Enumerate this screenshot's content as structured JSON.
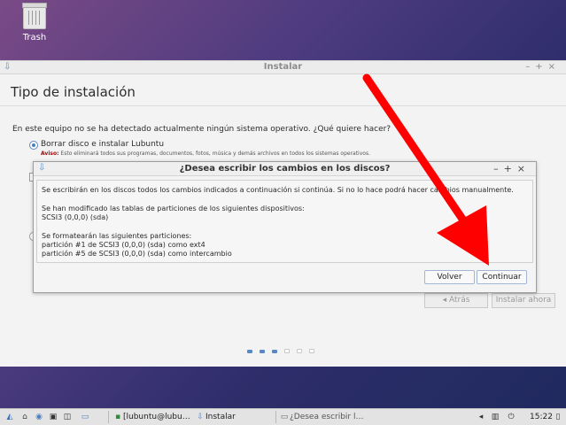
{
  "desktop": {
    "trash_label": "Trash"
  },
  "installer": {
    "window_title": "Instalar",
    "heading": "Tipo de instalación",
    "question": "En este equipo no se ha detectado actualmente ningún sistema operativo. ¿Qué quiere hacer?",
    "option_selected": "Borrar disco e instalar Lubuntu",
    "warning_label": "Aviso:",
    "warning_text": "Esto eliminará todos sus programas, documentos, fotos, música y demás archivos en todos los sistemas operativos.",
    "back_label": "Atrás",
    "install_label": "Instalar ahora",
    "steps_total": 6,
    "steps_done": 3
  },
  "dialog": {
    "title": "¿Desea escribir los cambios en los discos?",
    "line1": "Se escribirán en los discos todos los cambios indicados a continuación si continúa. Si no lo hace podrá hacer cambios manualmente.",
    "line2": "Se han modificado las tablas de particiones de los siguientes dispositivos:",
    "line3": "SCSI3 (0,0,0) (sda)",
    "line4": "Se formatearán las siguientes particiones:",
    "line5": " partición #1 de SCSI3 (0,0,0) (sda) como ext4",
    "line6": " partición #5 de SCSI3 (0,0,0) (sda) como intercambio",
    "back_button": "Volver",
    "continue_button": "Continuar"
  },
  "taskbar": {
    "terminal_task": "[lubuntu@lubu…",
    "installer_task": "Instalar",
    "dialog_task": "¿Desea escribir l…",
    "clock": "15:22"
  },
  "colors": {
    "accent": "#5b88c4",
    "annotation_arrow": "#ff0000"
  }
}
